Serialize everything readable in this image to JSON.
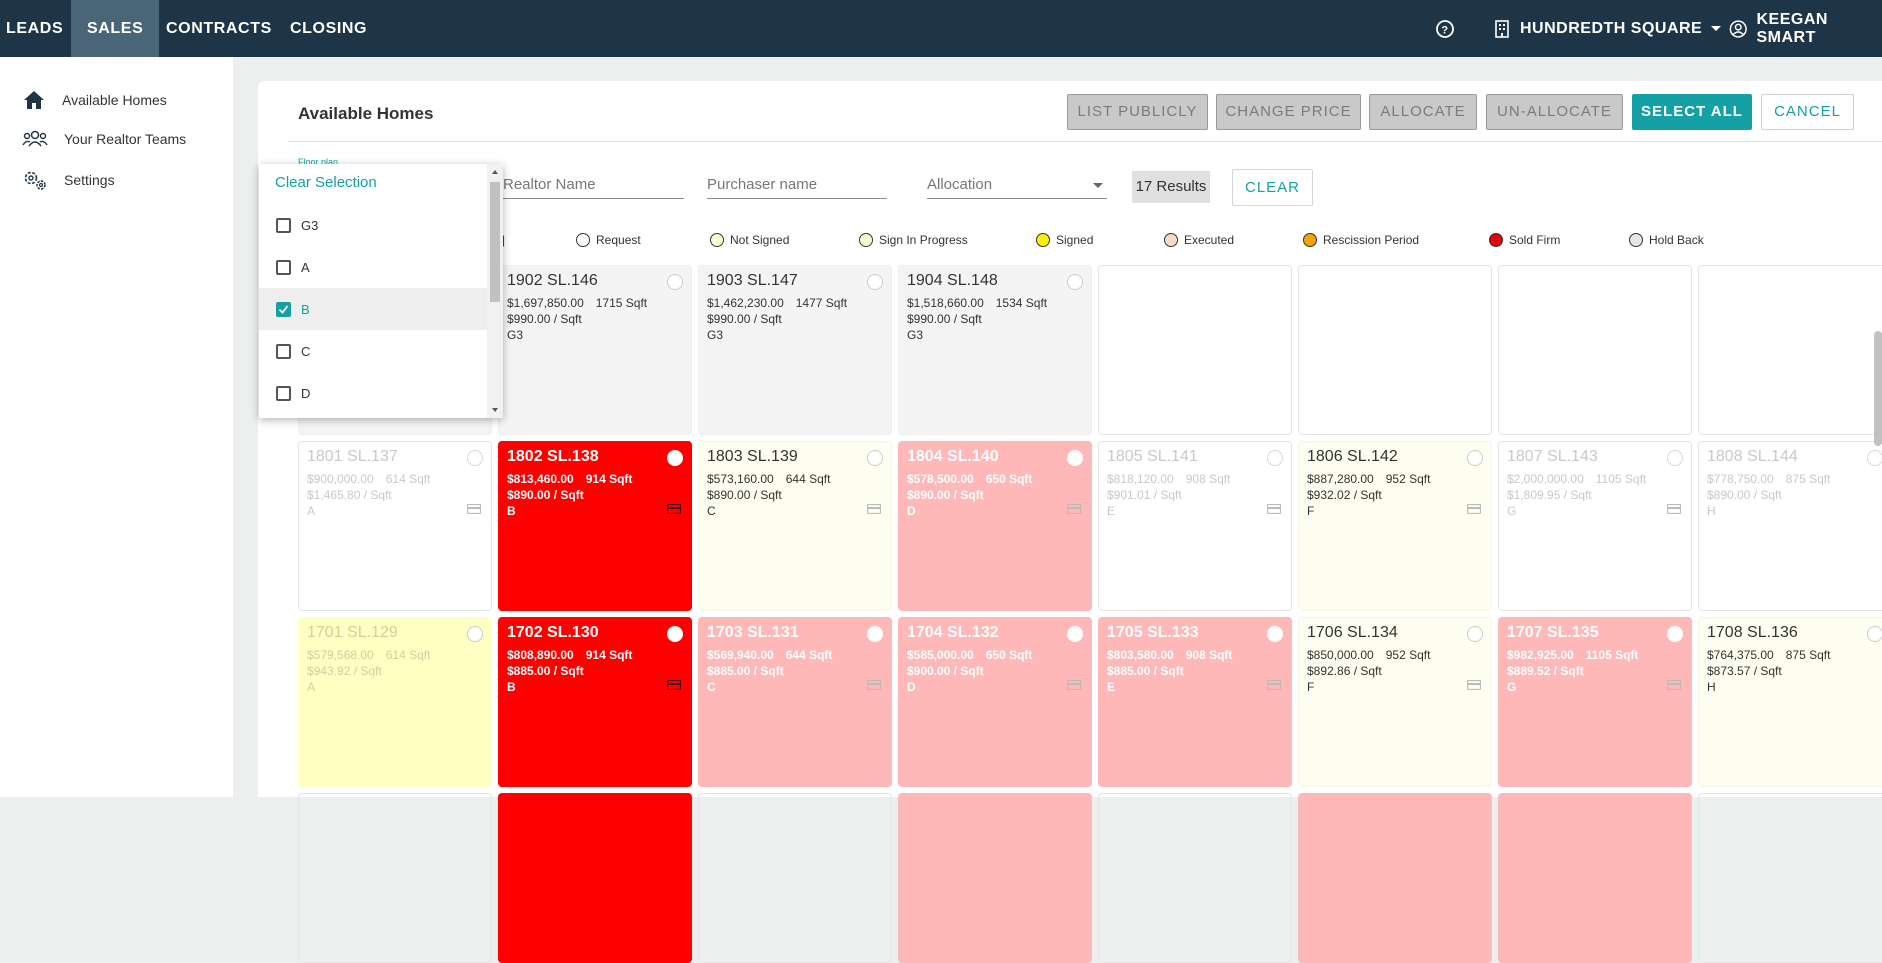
{
  "topbar": {
    "nav": [
      "LEADS",
      "SALES",
      "CONTRACTS",
      "CLOSING"
    ],
    "project": "HUNDREDTH SQUARE",
    "user": "KEEGAN SMART"
  },
  "sidebar": {
    "items": [
      "Available Homes",
      "Your Realtor Teams",
      "Settings"
    ]
  },
  "panel": {
    "title": "Available Homes",
    "buttons": {
      "list_publicly": "LIST PUBLICLY",
      "change_price": "CHANGE PRICE",
      "allocate": "ALLOCATE",
      "unallocate": "UN-ALLOCATE",
      "select_all": "SELECT ALL",
      "cancel": "CANCEL"
    },
    "filters": {
      "floor_plan_label": "Floor plan",
      "realtor_placeholder": "Realtor Name",
      "purchaser_placeholder": "Purchaser name",
      "allocation_placeholder": "Allocation",
      "results": "17 Results",
      "clear": "CLEAR"
    },
    "legend": [
      {
        "label": "Request",
        "color": "#ffffff"
      },
      {
        "label": "Not Signed",
        "color": "#fefcd2"
      },
      {
        "label": "Sign In Progress",
        "color": "#fefcd2"
      },
      {
        "label": "Signed",
        "color": "#f7f200"
      },
      {
        "label": "Executed",
        "color": "#f8d9c3"
      },
      {
        "label": "Rescission Period",
        "color": "#f5a300"
      },
      {
        "label": "Sold Firm",
        "color": "#e30000"
      },
      {
        "label": "Hold Back",
        "color": "#e6e6e6"
      }
    ]
  },
  "dropdown": {
    "clear_selection": "Clear Selection",
    "options": [
      {
        "label": "G3",
        "checked": false
      },
      {
        "label": "A",
        "checked": false
      },
      {
        "label": "B",
        "checked": true
      },
      {
        "label": "C",
        "checked": false
      },
      {
        "label": "D",
        "checked": false
      }
    ]
  },
  "units": {
    "row19": [
      {
        "unit": "1902 SL.146",
        "price": "$1,697,850.00",
        "sqft": "1715 Sqft",
        "psf": "$990.00 / Sqft",
        "plan": "G3",
        "style": "gray"
      },
      {
        "unit": "1903 SL.147",
        "price": "$1,462,230.00",
        "sqft": "1477 Sqft",
        "psf": "$990.00 / Sqft",
        "plan": "G3",
        "style": "gray"
      },
      {
        "unit": "1904 SL.148",
        "price": "$1,518,660.00",
        "sqft": "1534 Sqft",
        "psf": "$990.00 / Sqft",
        "plan": "G3",
        "style": "gray"
      }
    ],
    "row18": [
      {
        "unit": "1801 SL.137",
        "price": "$900,000.00",
        "sqft": "614 Sqft",
        "psf": "$1,465.80 / Sqft",
        "plan": "A",
        "style": "faded"
      },
      {
        "unit": "1802 SL.138",
        "price": "$813,460.00",
        "sqft": "914 Sqft",
        "psf": "$890.00 / Sqft",
        "plan": "B",
        "style": "red"
      },
      {
        "unit": "1803 SL.139",
        "price": "$573,160.00",
        "sqft": "644 Sqft",
        "psf": "$890.00 / Sqft",
        "plan": "C",
        "style": "cream"
      },
      {
        "unit": "1804 SL.140",
        "price": "$578,500.00",
        "sqft": "650 Sqft",
        "psf": "$890.00 / Sqft",
        "plan": "D",
        "style": "pink"
      },
      {
        "unit": "1805 SL.141",
        "price": "$818,120.00",
        "sqft": "908 Sqft",
        "psf": "$901.01 / Sqft",
        "plan": "E",
        "style": "faded"
      },
      {
        "unit": "1806 SL.142",
        "price": "$887,280.00",
        "sqft": "952 Sqft",
        "psf": "$932.02 / Sqft",
        "plan": "F",
        "style": "cream"
      },
      {
        "unit": "1807 SL.143",
        "price": "$2,000,000.00",
        "sqft": "1105 Sqft",
        "psf": "$1,809.95 / Sqft",
        "plan": "G",
        "style": "faded"
      },
      {
        "unit": "1808 SL.144",
        "price": "$778,750.00",
        "sqft": "875 Sqft",
        "psf": "$890.00 / Sqft",
        "plan": "H",
        "style": "faded"
      }
    ],
    "row17": [
      {
        "unit": "1701 SL.129",
        "price": "$579,568.00",
        "sqft": "614 Sqft",
        "psf": "$943.92 / Sqft",
        "plan": "A",
        "style": "yellow"
      },
      {
        "unit": "1702 SL.130",
        "price": "$808,890.00",
        "sqft": "914 Sqft",
        "psf": "$885.00 / Sqft",
        "plan": "B",
        "style": "red"
      },
      {
        "unit": "1703 SL.131",
        "price": "$569,940.00",
        "sqft": "644 Sqft",
        "psf": "$885.00 / Sqft",
        "plan": "C",
        "style": "pink"
      },
      {
        "unit": "1704 SL.132",
        "price": "$585,000.00",
        "sqft": "650 Sqft",
        "psf": "$900.00 / Sqft",
        "plan": "D",
        "style": "pink"
      },
      {
        "unit": "1705 SL.133",
        "price": "$803,580.00",
        "sqft": "908 Sqft",
        "psf": "$885.00 / Sqft",
        "plan": "E",
        "style": "pink"
      },
      {
        "unit": "1706 SL.134",
        "price": "$850,000.00",
        "sqft": "952 Sqft",
        "psf": "$892.86 / Sqft",
        "plan": "F",
        "style": "cream"
      },
      {
        "unit": "1707 SL.135",
        "price": "$982,925.00",
        "sqft": "1105 Sqft",
        "psf": "$889.52 / Sqft",
        "plan": "G",
        "style": "pink"
      },
      {
        "unit": "1708 SL.136",
        "price": "$764,375.00",
        "sqft": "875 Sqft",
        "psf": "$873.57 / Sqft",
        "plan": "H",
        "style": "cream"
      }
    ]
  }
}
